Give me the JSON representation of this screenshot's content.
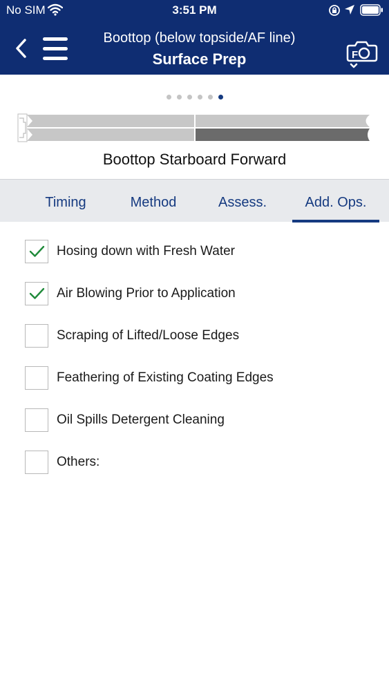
{
  "status_bar": {
    "carrier": "No SIM",
    "time": "3:51 PM"
  },
  "nav": {
    "subtitle": "Boottop (below topside/AF line)",
    "title": "Surface Prep",
    "back_icon": "chevron-left-icon",
    "menu_icon": "hamburger-menu-icon",
    "camera_icon": "camera-icon"
  },
  "pager": {
    "total": 6,
    "active_index": 5
  },
  "location": "Boottop Starboard Forward",
  "tabs": [
    {
      "label": "Timing",
      "active": false
    },
    {
      "label": "Method",
      "active": false
    },
    {
      "label": "Assess.",
      "active": false
    },
    {
      "label": "Add. Ops.",
      "active": true
    }
  ],
  "options": [
    {
      "label": "Hosing down with Fresh Water",
      "checked": true
    },
    {
      "label": "Air Blowing Prior to Application",
      "checked": true
    },
    {
      "label": "Scraping of Lifted/Loose Edges",
      "checked": false
    },
    {
      "label": "Feathering of Existing Coating Edges",
      "checked": false
    },
    {
      "label": "Oil Spills Detergent Cleaning",
      "checked": false
    },
    {
      "label": "Others:",
      "checked": false
    }
  ],
  "colors": {
    "header": "#0f2d72",
    "accent": "#153a80",
    "check": "#1f8a3a",
    "tabs_bg": "#e8eaed"
  }
}
